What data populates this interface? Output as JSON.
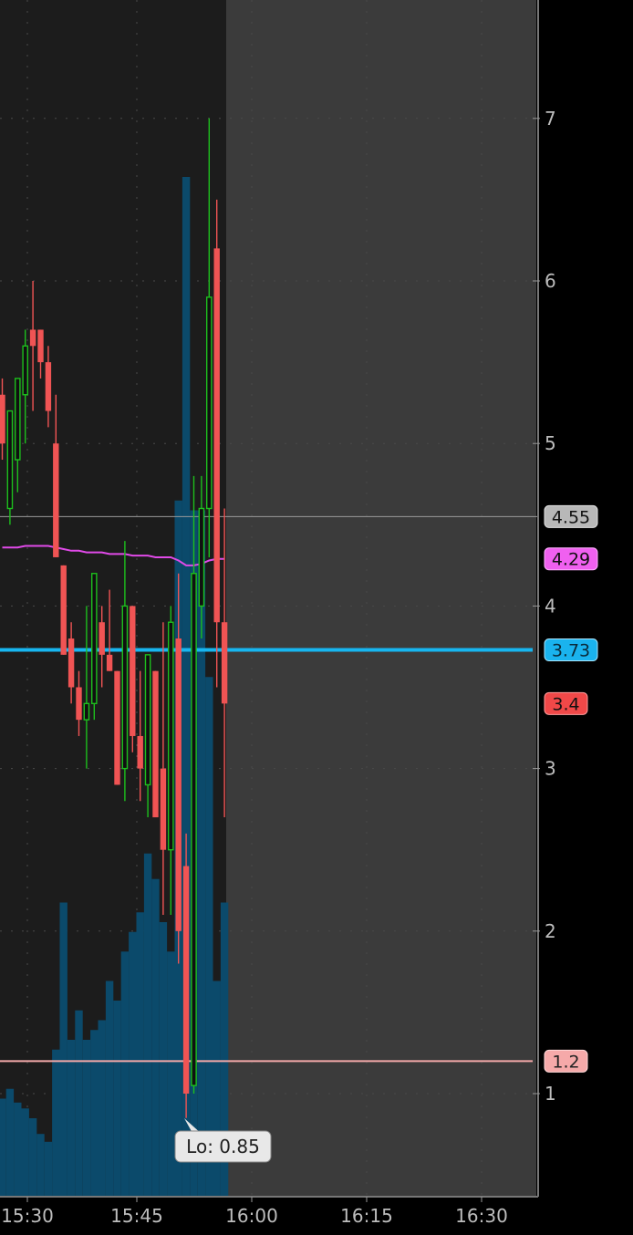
{
  "colors": {
    "background": "#000000",
    "plot_bg": "#1c1c1c",
    "future_bg": "#3b3b3b",
    "up": "#1dbf1d",
    "down": "#f05454",
    "volume": "#0b4a6b",
    "vwap": "#e04ae8",
    "cyan_line": "#17b6f0",
    "pink_line": "#f2a8a8",
    "gray_line": "#9a9a9a",
    "axis_text": "#bdbdbd"
  },
  "chart_data": {
    "type": "candlestick",
    "y_ticks": [
      "1",
      "2",
      "3",
      "4",
      "5",
      "6",
      "7"
    ],
    "x_ticks": [
      "15:30",
      "15:45",
      "16:00",
      "16:15",
      "16:30"
    ],
    "ylim": [
      0.38,
      7.3
    ],
    "grid": "dotted",
    "candles": [
      {
        "o": 5.3,
        "h": 5.4,
        "l": 4.9,
        "c": 5.0,
        "v": 0.5
      },
      {
        "o": 4.6,
        "h": 5.2,
        "l": 4.5,
        "c": 5.2,
        "v": 0.55
      },
      {
        "o": 4.9,
        "h": 5.4,
        "l": 4.7,
        "c": 5.4,
        "v": 0.48
      },
      {
        "o": 5.3,
        "h": 5.7,
        "l": 5.0,
        "c": 5.6,
        "v": 0.45
      },
      {
        "o": 5.7,
        "h": 6.0,
        "l": 5.2,
        "c": 5.6,
        "v": 0.4
      },
      {
        "o": 5.7,
        "h": 5.7,
        "l": 5.4,
        "c": 5.5,
        "v": 0.32
      },
      {
        "o": 5.5,
        "h": 5.6,
        "l": 5.1,
        "c": 5.2,
        "v": 0.28
      },
      {
        "o": 5.0,
        "h": 5.3,
        "l": 4.3,
        "c": 4.3,
        "v": 0.75
      },
      {
        "o": 4.25,
        "h": 4.25,
        "l": 3.7,
        "c": 3.7,
        "v": 1.5
      },
      {
        "o": 3.8,
        "h": 3.9,
        "l": 3.4,
        "c": 3.5,
        "v": 0.8
      },
      {
        "o": 3.5,
        "h": 3.6,
        "l": 3.2,
        "c": 3.3,
        "v": 0.95
      },
      {
        "o": 3.3,
        "h": 4.0,
        "l": 3.0,
        "c": 3.4,
        "v": 0.8
      },
      {
        "o": 3.4,
        "h": 4.2,
        "l": 3.3,
        "c": 4.2,
        "v": 0.85
      },
      {
        "o": 3.9,
        "h": 4.0,
        "l": 3.5,
        "c": 3.7,
        "v": 0.9
      },
      {
        "o": 3.7,
        "h": 4.1,
        "l": 3.6,
        "c": 3.6,
        "v": 1.1
      },
      {
        "o": 3.6,
        "h": 3.6,
        "l": 2.9,
        "c": 2.9,
        "v": 1.0
      },
      {
        "o": 3.0,
        "h": 4.4,
        "l": 2.8,
        "c": 4.0,
        "v": 1.25
      },
      {
        "o": 4.0,
        "h": 4.0,
        "l": 3.1,
        "c": 3.2,
        "v": 1.35
      },
      {
        "o": 3.2,
        "h": 3.6,
        "l": 2.8,
        "c": 3.0,
        "v": 1.45
      },
      {
        "o": 2.9,
        "h": 3.7,
        "l": 2.7,
        "c": 3.7,
        "v": 1.75
      },
      {
        "o": 3.6,
        "h": 3.6,
        "l": 2.7,
        "c": 2.7,
        "v": 1.62
      },
      {
        "o": 3.0,
        "h": 3.9,
        "l": 2.1,
        "c": 2.5,
        "v": 1.4
      },
      {
        "o": 2.5,
        "h": 4.0,
        "l": 2.1,
        "c": 3.9,
        "v": 1.25
      },
      {
        "o": 3.8,
        "h": 4.2,
        "l": 1.8,
        "c": 2.0,
        "v": 3.55
      },
      {
        "o": 2.4,
        "h": 2.6,
        "l": 0.85,
        "c": 1.0,
        "v": 5.2
      },
      {
        "o": 1.05,
        "h": 4.8,
        "l": 1.0,
        "c": 4.2,
        "v": 3.5
      },
      {
        "o": 4.0,
        "h": 4.8,
        "l": 3.8,
        "c": 4.6,
        "v": 3.5
      },
      {
        "o": 4.6,
        "h": 7.0,
        "l": 4.3,
        "c": 5.9,
        "v": 2.65
      },
      {
        "o": 6.2,
        "h": 6.5,
        "l": 3.5,
        "c": 3.9,
        "v": 1.1
      },
      {
        "o": 3.9,
        "h": 4.6,
        "l": 2.7,
        "c": 3.4,
        "v": 1.5
      }
    ],
    "vwap": [
      4.36,
      4.36,
      4.36,
      4.37,
      4.37,
      4.37,
      4.37,
      4.36,
      4.35,
      4.34,
      4.34,
      4.33,
      4.33,
      4.33,
      4.32,
      4.32,
      4.32,
      4.31,
      4.31,
      4.31,
      4.3,
      4.3,
      4.3,
      4.28,
      4.25,
      4.25,
      4.26,
      4.28,
      4.29,
      4.29
    ],
    "levels": [
      {
        "name": "gray",
        "value": 4.55,
        "label": "4.55"
      },
      {
        "name": "vwap",
        "value": 4.29,
        "label": "4.29"
      },
      {
        "name": "cyan",
        "value": 3.73,
        "label": "3.73"
      },
      {
        "name": "last",
        "value": 3.4,
        "label": "3.4"
      },
      {
        "name": "pink",
        "value": 1.2,
        "label": "1.2"
      }
    ],
    "low_annotation": {
      "label": "Lo: 0.85",
      "value": 0.85
    }
  }
}
